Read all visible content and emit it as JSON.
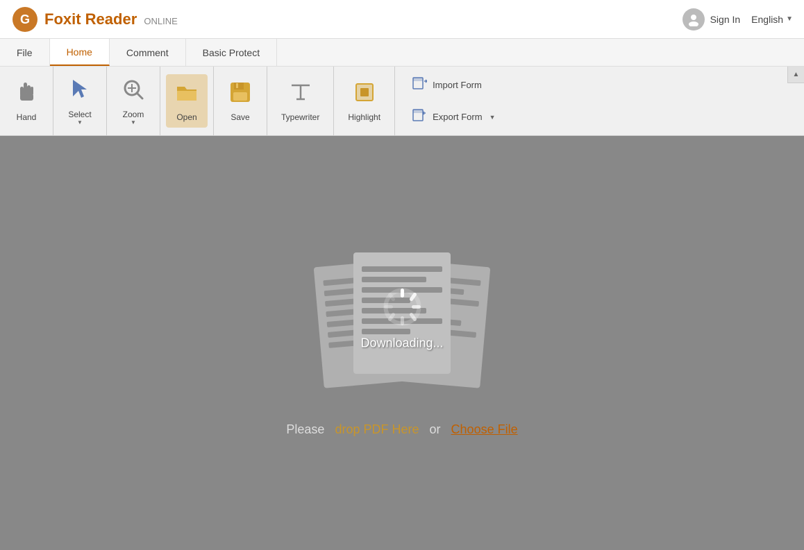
{
  "header": {
    "logo_main": "Foxit Reader",
    "logo_sub": "ONLINE",
    "sign_in_label": "Sign In",
    "language": "English"
  },
  "nav": {
    "tabs": [
      {
        "id": "file",
        "label": "File"
      },
      {
        "id": "home",
        "label": "Home",
        "active": true
      },
      {
        "id": "comment",
        "label": "Comment"
      },
      {
        "id": "basic_protect",
        "label": "Basic Protect"
      }
    ]
  },
  "toolbar": {
    "buttons": [
      {
        "id": "hand",
        "label": "Hand",
        "icon": "hand"
      },
      {
        "id": "select",
        "label": "Select",
        "icon": "select",
        "has_arrow": true
      },
      {
        "id": "zoom",
        "label": "Zoom",
        "icon": "zoom",
        "has_arrow": true
      },
      {
        "id": "open",
        "label": "Open",
        "icon": "open",
        "active": true
      },
      {
        "id": "save",
        "label": "Save",
        "icon": "save"
      },
      {
        "id": "typewriter",
        "label": "Typewriter",
        "icon": "typewriter"
      },
      {
        "id": "highlight",
        "label": "Highlight",
        "icon": "highlight"
      }
    ],
    "form_buttons": [
      {
        "id": "import_form",
        "label": "Import Form"
      },
      {
        "id": "export_form",
        "label": "Export Form",
        "has_arrow": true
      }
    ]
  },
  "main": {
    "downloading_text": "Downloading...",
    "please_text": "Please",
    "drop_text": "drop PDF Here",
    "or_text": "or",
    "choose_text": "Choose File"
  }
}
